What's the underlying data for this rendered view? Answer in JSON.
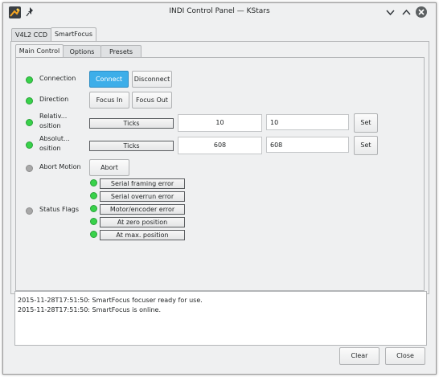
{
  "window": {
    "title": "INDI Control Panel — KStars"
  },
  "titlebar": {
    "app_icon": "kstars-app-icon",
    "pin_icon": "pin-icon",
    "minimize_icon": "chevron-down-icon",
    "maximize_icon": "chevron-up-icon",
    "close_icon": "close-icon"
  },
  "device_tabs": [
    {
      "label": "V4L2 CCD"
    },
    {
      "label": "SmartFocus"
    }
  ],
  "sub_tabs": [
    {
      "label": "Main Control"
    },
    {
      "label": "Options"
    },
    {
      "label": "Presets"
    }
  ],
  "main": {
    "connection": {
      "label": "Connection",
      "connect": "Connect",
      "disconnect": "Disconnect"
    },
    "direction": {
      "label": "Direction",
      "focus_in": "Focus In",
      "focus_out": "Focus Out"
    },
    "relative": {
      "label_line1": "Relativ...",
      "label_line2": "osition",
      "element": "Ticks",
      "current": "10",
      "input": "10",
      "set": "Set"
    },
    "absolute": {
      "label_line1": "Absolut...",
      "label_line2": "osition",
      "element": "Ticks",
      "current": "608",
      "input": "608",
      "set": "Set"
    },
    "abort": {
      "label": "Abort Motion",
      "button": "Abort"
    },
    "status": {
      "label": "Status Flags",
      "flags": [
        "Serial framing error",
        "Serial overrun error",
        "Motor/encoder error",
        "At zero position",
        "At max. position"
      ]
    }
  },
  "log": [
    "2015-11-28T17:51:50: SmartFocus focuser ready for use.",
    "2015-11-28T17:51:50: SmartFocus is online."
  ],
  "footer": {
    "clear": "Clear",
    "close": "Close"
  },
  "colors": {
    "accent": "#3daee9",
    "led_ok": "#38d24a",
    "led_idle": "#a8a8a8"
  }
}
